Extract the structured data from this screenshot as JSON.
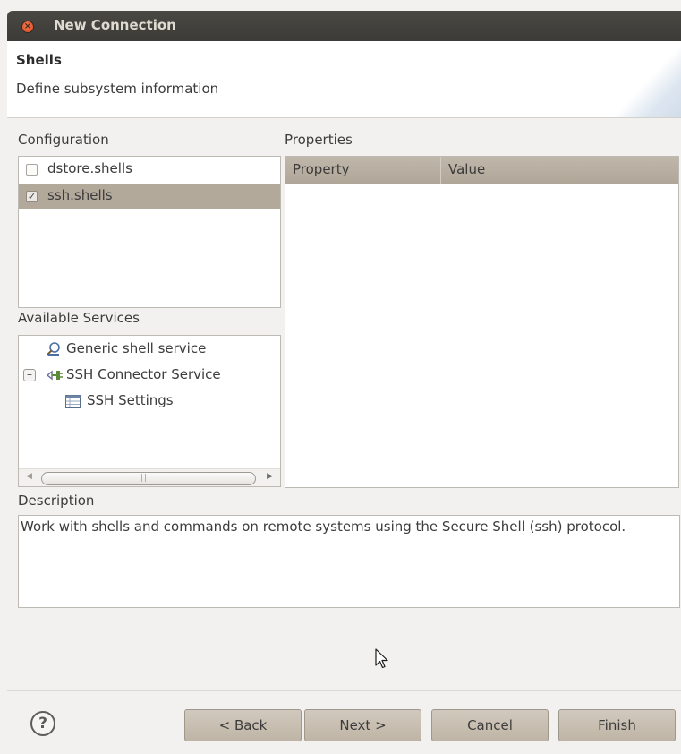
{
  "window": {
    "title": "New Connection"
  },
  "header": {
    "title": "Shells",
    "description": "Define subsystem information"
  },
  "configuration": {
    "label": "Configuration",
    "items": [
      {
        "label": "dstore.shells",
        "checked": false,
        "check_mark": ""
      },
      {
        "label": "ssh.shells",
        "checked": true,
        "check_mark": "✓"
      }
    ]
  },
  "properties": {
    "label": "Properties",
    "columns": [
      "Property",
      "Value"
    ]
  },
  "services": {
    "label": "Available Services",
    "items": [
      {
        "label": "Generic shell service",
        "icon": "shell-service-icon"
      },
      {
        "label": "SSH Connector Service",
        "icon": "connector-service-icon",
        "expanded": true,
        "toggle": "–"
      },
      {
        "label": "SSH Settings",
        "icon": "settings-table-icon"
      }
    ]
  },
  "description": {
    "label": "Description",
    "text": "Work with shells and commands on remote systems using the Secure Shell (ssh) protocol."
  },
  "buttons": {
    "help": "?",
    "back": "< Back",
    "next": "Next >",
    "cancel": "Cancel",
    "finish": "Finish"
  },
  "colors": {
    "titlebar": "#3c3b37",
    "selection": "#b3a99b",
    "table_header": "#b8ae a0",
    "button": "#c8bfb2"
  }
}
